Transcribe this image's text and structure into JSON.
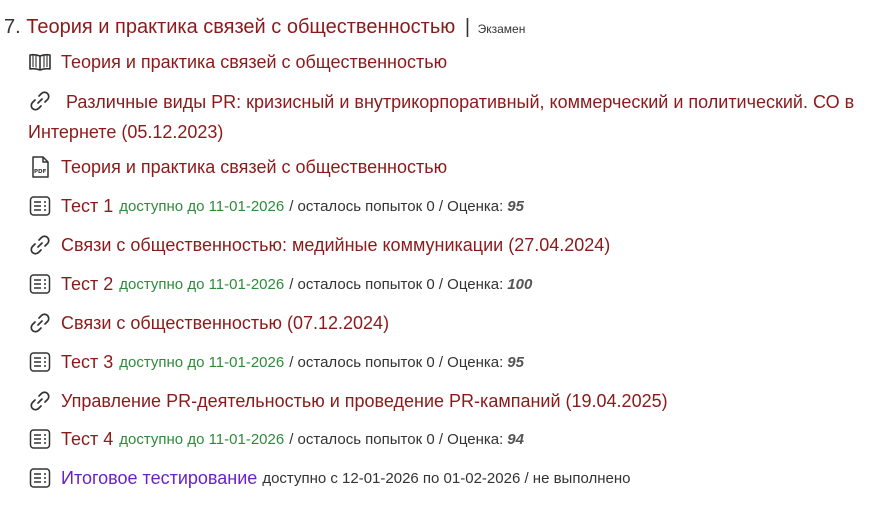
{
  "section": {
    "number": "7.",
    "title": "Теория и практика связей с общественностью",
    "separator": "|",
    "badge": "Экзамен"
  },
  "items": [
    {
      "icon": "book-icon",
      "title": "Теория и практика связей с общественностью"
    },
    {
      "icon": "link-icon",
      "title": "Различные виды PR: кризисный и внутрикорпоративный, коммерческий и политический. СО в Интернете (05.12.2023)"
    },
    {
      "icon": "pdf-icon",
      "title": "Теория и практика связей с общественностью"
    },
    {
      "icon": "test-icon",
      "title": "Тест 1",
      "availability": "доступно до 11-01-2026",
      "meta": "/ осталось попыток 0 / Оценка:",
      "score": "95"
    },
    {
      "icon": "link-icon",
      "title": "Связи с общественностью: медийные коммуникации (27.04.2024)"
    },
    {
      "icon": "test-icon",
      "title": "Тест 2",
      "availability": "доступно до 11-01-2026",
      "meta": "/ осталось попыток 0 / Оценка:",
      "score": "100"
    },
    {
      "icon": "link-icon",
      "title": "Связи с общественностью (07.12.2024)"
    },
    {
      "icon": "test-icon",
      "title": "Тест 3",
      "availability": "доступно до 11-01-2026",
      "meta": "/ осталось попыток 0 / Оценка:",
      "score": "95"
    },
    {
      "icon": "link-icon",
      "title": "Управление PR-деятельностью и проведение PR-кампаний (19.04.2025)"
    },
    {
      "icon": "test-icon",
      "title": "Тест 4",
      "availability": "доступно до 11-01-2026",
      "meta": "/ осталось попыток 0 / Оценка:",
      "score": "94"
    },
    {
      "icon": "test-icon",
      "title": "Итоговое тестирование",
      "meta": "доступно с 12-01-2026 по 01-02-2026 / не выполнено"
    }
  ],
  "colors": {
    "link": "#8b1a1a",
    "final_link": "#6b21c8",
    "availability": "#2e8b3a"
  }
}
